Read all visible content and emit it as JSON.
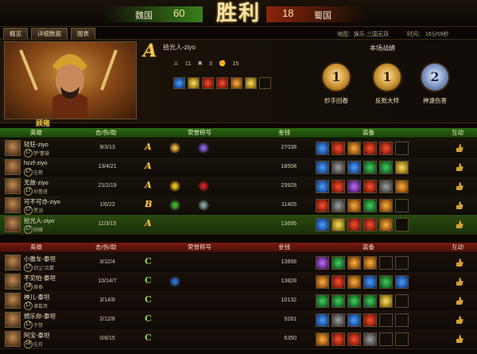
{
  "banner": {
    "team_left": "魏国",
    "score_left": "60",
    "result": "胜利",
    "score_right": "18",
    "team_right": "蜀国"
  },
  "tabs": [
    "概览",
    "详细数据",
    "图表"
  ],
  "match": {
    "map": "地图：娱乐.三国无双",
    "time": "时间： 16分59秒"
  },
  "player": {
    "rank": "A",
    "name": "拾光人-ziyo",
    "kills": "11",
    "deaths": "3",
    "assists": "15"
  },
  "best": {
    "title": "本场战绩",
    "badges": [
      {
        "num": "1",
        "label": "妙手回春",
        "kind": "gold"
      },
      {
        "num": "1",
        "label": "反败大师",
        "kind": "gold"
      },
      {
        "num": "2",
        "label": "神速伤害",
        "kind": "silver"
      }
    ]
  },
  "team_left_title": "顾雍",
  "columns": {
    "hero": "英雄",
    "kda": "击/伤/助",
    "honor": "荣誉称号",
    "gold": "金钱",
    "equip": "装备",
    "interact": "互动"
  },
  "team_left_rows": [
    {
      "name": "轻狂-ziyo",
      "level": "17",
      "general": "梦“曹操",
      "kda": "9/3/13",
      "rank": "A",
      "gold": "27038",
      "honors": [
        "#e8b040",
        "#8060e0"
      ],
      "equip": [
        "e1",
        "e2",
        "e3",
        "e2",
        "e2",
        "e0"
      ]
    },
    {
      "name": "hzzf-ziyo",
      "level": "17",
      "general": "左慈",
      "kda": "13/4/21",
      "rank": "A",
      "gold": "18508",
      "honors": [],
      "equip": [
        "e1",
        "e7",
        "e1",
        "e4",
        "e4",
        "e6"
      ]
    },
    {
      "name": "无故-ziyo",
      "level": "17",
      "general": "孙鲁班",
      "kda": "21/2/19",
      "rank": "A",
      "gold": "23928",
      "honors": [
        "#e8c020",
        "#d02020"
      ],
      "equip": [
        "e1",
        "e2",
        "e5",
        "e2",
        "e7",
        "e3"
      ]
    },
    {
      "name": "可不可亦-ziyo",
      "level": "17",
      "general": "贾诩",
      "kda": "1/6/22",
      "rank": "B",
      "gold": "11405",
      "honors": [
        "#40b030",
        "#80a0a0"
      ],
      "equip": [
        "e2",
        "e7",
        "e3",
        "e4",
        "e3",
        "e0"
      ]
    },
    {
      "name": "拾光人-ziyo",
      "level": "17",
      "general": "顾雍",
      "kda": "11/3/15",
      "rank": "A",
      "gold": "13695",
      "honors": [],
      "equip": [
        "e1",
        "e6",
        "e2",
        "e2",
        "e3",
        "e0"
      ],
      "me": true
    }
  ],
  "team_right_rows": [
    {
      "name": "小雅车-泰坦",
      "level": "17",
      "general": "剑尘“吕蒙",
      "kda": "3/12/4",
      "rank": "C",
      "gold": "13858",
      "honors": [],
      "equip": [
        "e5",
        "e4",
        "e3",
        "e3",
        "e0",
        "e0"
      ]
    },
    {
      "name": "不见怕-泰坦",
      "level": "18",
      "general": "周泰",
      "kda": "10/14/7",
      "rank": "C",
      "gold": "13828",
      "honors": [
        "#3070d0"
      ],
      "equip": [
        "e3",
        "e2",
        "e3",
        "e1",
        "e4",
        "e1"
      ]
    },
    {
      "name": "神儿-泰坦",
      "level": "17",
      "general": "诸葛亮",
      "kda": "3/14/8",
      "rank": "C",
      "gold": "10132",
      "honors": [],
      "equip": [
        "e4",
        "e4",
        "e4",
        "e4",
        "e6",
        "e0"
      ]
    },
    {
      "name": "燃乐你-泰坦",
      "level": "17",
      "general": "于禁",
      "kda": "2/12/8",
      "rank": "C",
      "gold": "9281",
      "honors": [],
      "equip": [
        "e1",
        "e7",
        "e1",
        "e2",
        "e0",
        "e0"
      ]
    },
    {
      "name": "阿宝-泰坦",
      "level": "16",
      "general": "左月",
      "kda": "0/8/15",
      "rank": "C",
      "gold": "6350",
      "honors": [],
      "equip": [
        "e3",
        "e2",
        "e2",
        "e7",
        "e0",
        "e0"
      ]
    }
  ],
  "colors": {
    "gold": "#f0c850",
    "win_green": "#2c6a14",
    "lose_red": "#7a1a0c"
  }
}
